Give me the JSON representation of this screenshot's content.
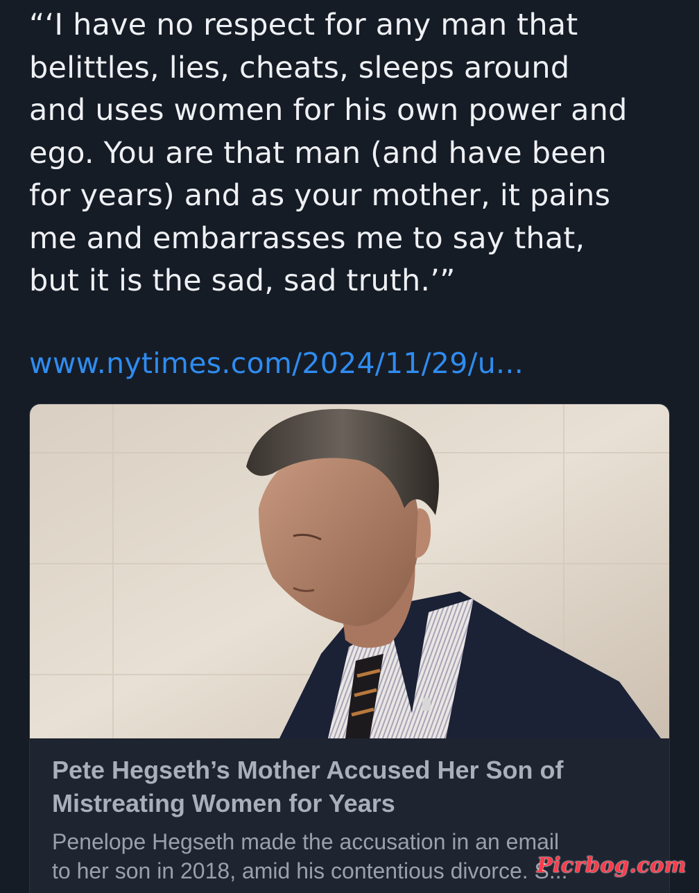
{
  "post": {
    "quote_lines": [
      "“‘I have no respect for any man that",
      "belittles, lies, cheats, sleeps around",
      "and uses women for his own power and",
      "ego. You are that man (and have been",
      "for years) and as your mother, it pains",
      "me and embarrasses me to say that,",
      "but it is the sad, sad truth.’”"
    ],
    "link_text": "www.nytimes.com/2024/11/29/u..."
  },
  "link_card": {
    "title_lines": [
      "Pete Hegseth’s Mother Accused Her Son of",
      "Mistreating Women for Years"
    ],
    "description_lines": [
      "Penelope Hegseth made the accusation in an email",
      "to her son in 2018, amid his contentious divorce. S..."
    ]
  },
  "watermark": "Picrbog.com",
  "colors": {
    "background": "#161c26",
    "text": "#eef0f4",
    "link": "#2f8cf0",
    "card_body": "#1e2430",
    "card_title": "#a9b0bc",
    "card_description": "#9aa1ad",
    "watermark": "#ff3a4a"
  }
}
